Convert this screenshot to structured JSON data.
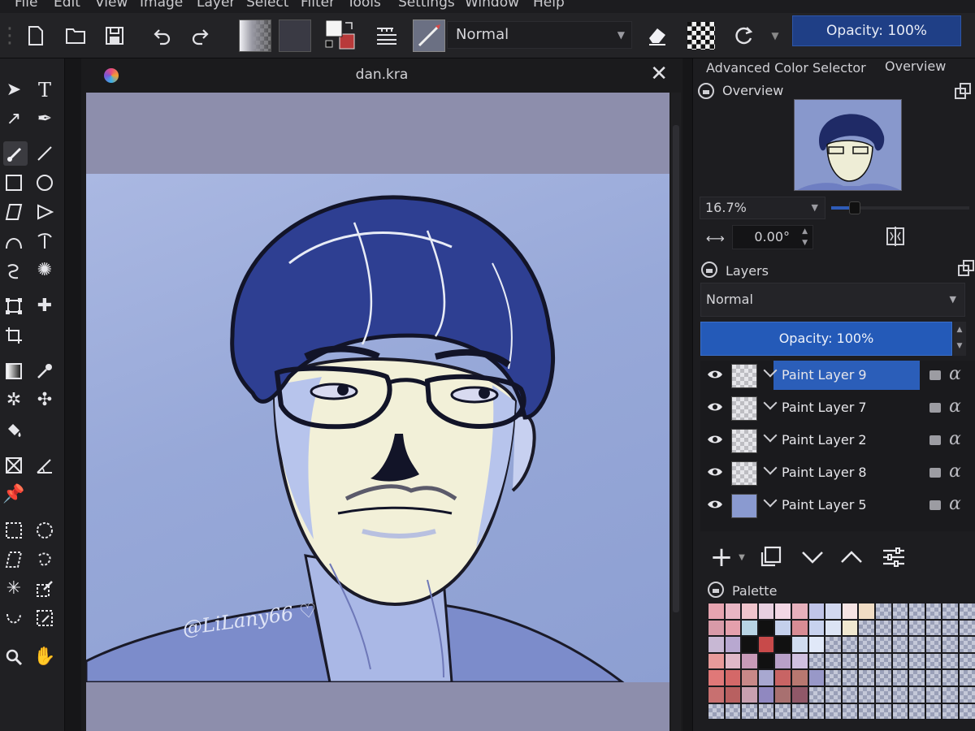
{
  "menu": [
    "File",
    "Edit",
    "View",
    "Image",
    "Layer",
    "Select",
    "Filter",
    "Tools",
    "Settings",
    "Window",
    "Help"
  ],
  "toolbar": {
    "blend_mode": "Normal",
    "opacity": "Opacity: 100%"
  },
  "document": {
    "title": "dan.kra",
    "signature": "@LiLany66"
  },
  "dock": {
    "tabs": [
      "Advanced Color Selector",
      "Overview"
    ],
    "overview": {
      "title": "Overview",
      "zoom": "16.7%",
      "rotation": "0.00°"
    },
    "layers": {
      "title": "Layers",
      "blend_mode": "Normal",
      "opacity": "Opacity:  100%",
      "items": [
        {
          "name": "Paint Layer 9",
          "selected": true
        },
        {
          "name": "Paint Layer 7",
          "selected": false
        },
        {
          "name": "Paint Layer 2",
          "selected": false
        },
        {
          "name": "Paint Layer 8",
          "selected": false
        },
        {
          "name": "Paint Layer 5",
          "selected": false
        }
      ]
    },
    "palette": {
      "title": "Palette"
    }
  },
  "colors": {
    "accent": "#245ab8",
    "canvas_bg": "#97a8d8"
  }
}
